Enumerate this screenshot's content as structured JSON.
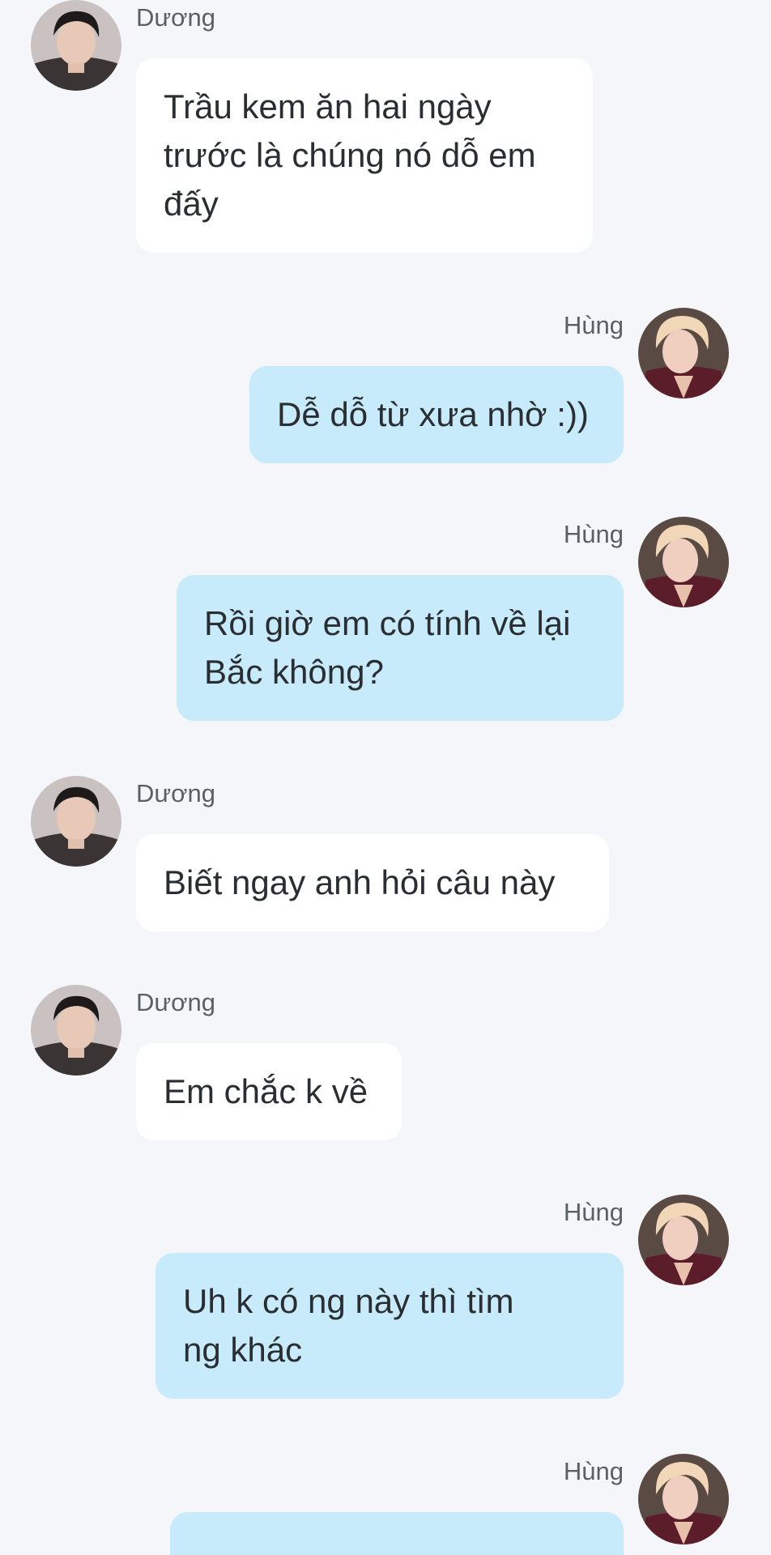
{
  "colors": {
    "background": "#f4f6f9",
    "incoming_bubble": "#ffffff",
    "outgoing_bubble": "#c7ebfb",
    "text": "#2a2d31",
    "sender_name": "#5b5f66"
  },
  "messages": [
    {
      "sender": "Dương",
      "text": "Trầu kem ăn hai ngày\ntrước là chúng nó dỗ em\nđấy"
    },
    {
      "sender": "Hùng",
      "text": "Dễ dỗ từ xưa nhờ :))"
    },
    {
      "sender": "Hùng",
      "text": "Rồi giờ em có tính về lại\nBắc không?"
    },
    {
      "sender": "Dương",
      "text": "Biết ngay anh hỏi câu này"
    },
    {
      "sender": "Dương",
      "text": "Em chắc k về"
    },
    {
      "sender": "Hùng",
      "text": "Uh k có ng này thì tìm\nng khác"
    },
    {
      "sender": "Hùng",
      "text": ""
    }
  ]
}
